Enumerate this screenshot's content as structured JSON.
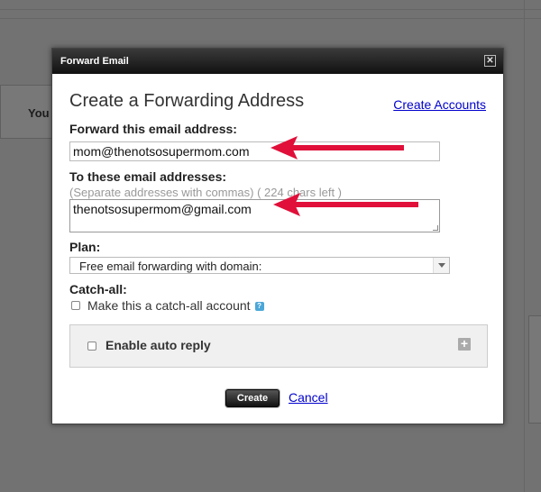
{
  "background": {
    "partial_text": "You"
  },
  "modal": {
    "title": "Forward Email",
    "close_glyph": "✕",
    "heading": "Create a Forwarding Address",
    "create_accounts_link": "Create Accounts",
    "forward_label": "Forward this email address:",
    "forward_value": "mom@thenotsosupermom.com",
    "to_label": "To these email addresses:",
    "to_hint": "(Separate addresses with commas) ( 224 chars left )",
    "to_value": "thenotsosupermom@gmail.com",
    "plan_label": "Plan:",
    "plan_selected": "Free email forwarding with domain:",
    "catchall_label": "Catch-all:",
    "catchall_checkbox_label": "Make this a catch-all account",
    "help_glyph": "?",
    "autoreply_label": "Enable auto reply",
    "plus_glyph": "+",
    "create_button": "Create",
    "cancel_link": "Cancel"
  },
  "colors": {
    "arrow": "#e0103a",
    "link": "#0000cc",
    "overlay": "#727272"
  }
}
